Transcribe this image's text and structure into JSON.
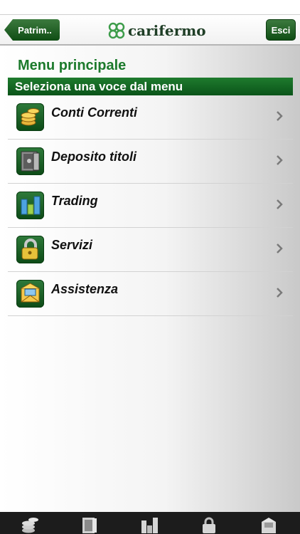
{
  "header": {
    "back_label": "Patrim..",
    "logo_text": "carifermo",
    "exit_label": "Esci"
  },
  "page_title": "Menu principale",
  "section_header": "Seleziona una voce dal menu",
  "menu": {
    "items": [
      {
        "label": "Conti Correnti",
        "icon": "coins-icon"
      },
      {
        "label": "Deposito titoli",
        "icon": "safe-icon"
      },
      {
        "label": "Trading",
        "icon": "chart-bars-icon"
      },
      {
        "label": "Servizi",
        "icon": "padlock-icon"
      },
      {
        "label": "Assistenza",
        "icon": "mail-icon"
      }
    ]
  },
  "tabbar": {
    "tabs": [
      {
        "icon": "coins-icon"
      },
      {
        "icon": "safe-icon"
      },
      {
        "icon": "chart-bars-icon"
      },
      {
        "icon": "padlock-icon"
      },
      {
        "icon": "mail-icon"
      }
    ]
  },
  "colors": {
    "brand_green": "#1c7a2c",
    "header_green": "#0a5419",
    "tabbar": "#1c1c1c"
  }
}
